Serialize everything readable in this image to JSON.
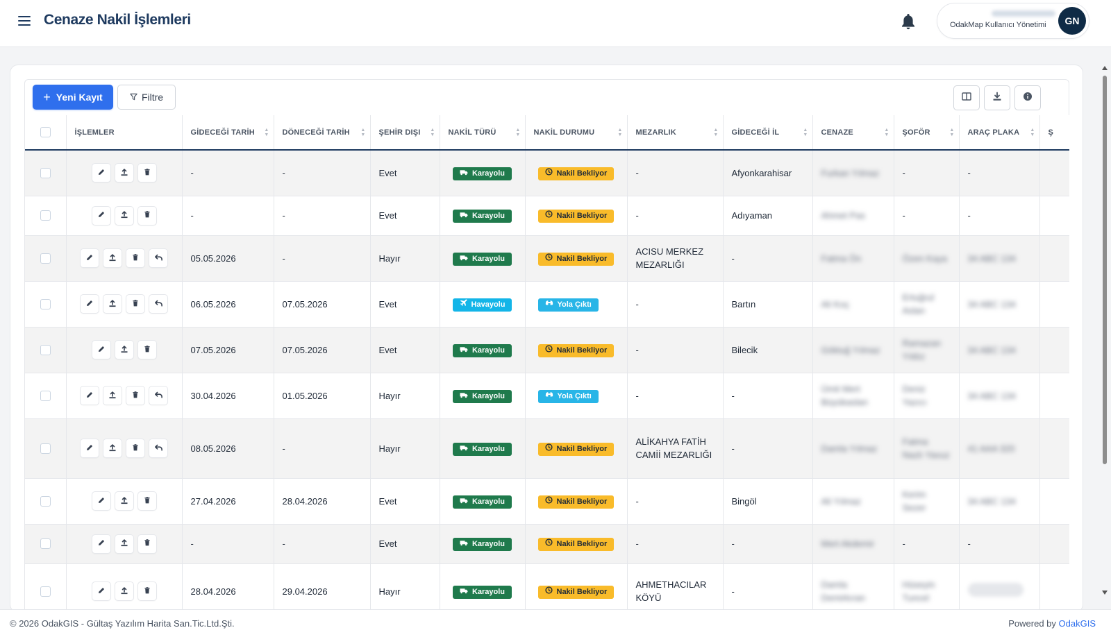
{
  "header": {
    "title": "Cenaze Nakil İşlemleri",
    "user_role": "OdakMap Kullanıcı Yönetimi",
    "avatar_initials": "GN"
  },
  "toolbar": {
    "new_label": "Yeni Kayıt",
    "filter_label": "Filtre"
  },
  "table": {
    "columns": [
      "İŞLEMLER",
      "GİDECEĞİ TARİH",
      "DÖNECEĞİ TARİH",
      "ŞEHİR DIŞI",
      "NAKİL TÜRÜ",
      "NAKİL DURUMU",
      "MEZARLIK",
      "GİDECEĞİ İL",
      "CENAZE",
      "ŞOFÖR",
      "ARAÇ PLAKA",
      "Ş"
    ],
    "rows": [
      {
        "gidecegi_tarih": "-",
        "donecegi_tarih": "-",
        "sehir_disi": "Evet",
        "nakil_turu": "Karayolu",
        "nakil_durumu": "Nakil Bekliyor",
        "mezarlik": "-",
        "gidecegi_il": "Afyonkarahisar",
        "cenaze": "Furkan Yılmaz",
        "sofor": "-",
        "arac_plaka": "-",
        "undo": false
      },
      {
        "gidecegi_tarih": "-",
        "donecegi_tarih": "-",
        "sehir_disi": "Evet",
        "nakil_turu": "Karayolu",
        "nakil_durumu": "Nakil Bekliyor",
        "mezarlik": "-",
        "gidecegi_il": "Adıyaman",
        "cenaze": "Ahmet Pas",
        "sofor": "-",
        "arac_plaka": "-",
        "undo": false
      },
      {
        "gidecegi_tarih": "05.05.2026",
        "donecegi_tarih": "-",
        "sehir_disi": "Hayır",
        "nakil_turu": "Karayolu",
        "nakil_durumu": "Nakil Bekliyor",
        "mezarlik": "ACISU MERKEZ MEZARLIĞI",
        "gidecegi_il": "-",
        "cenaze": "Fatma Ön",
        "sofor": "Özen Kaya",
        "arac_plaka": "34 ABC 134",
        "undo": true
      },
      {
        "gidecegi_tarih": "06.05.2026",
        "donecegi_tarih": "07.05.2026",
        "sehir_disi": "Evet",
        "nakil_turu": "Havayolu",
        "nakil_durumu": "Yola Çıktı",
        "mezarlik": "-",
        "gidecegi_il": "Bartın",
        "cenaze": "Ali Koç",
        "sofor": "Ertuğrul Aslan",
        "arac_plaka": "34 ABC 134",
        "undo": true
      },
      {
        "gidecegi_tarih": "07.05.2026",
        "donecegi_tarih": "07.05.2026",
        "sehir_disi": "Evet",
        "nakil_turu": "Karayolu",
        "nakil_durumu": "Nakil Bekliyor",
        "mezarlik": "-",
        "gidecegi_il": "Bilecik",
        "cenaze": "Göktuğ Yılmaz",
        "sofor": "Ramazan Yıldız",
        "arac_plaka": "34 ABC 134",
        "undo": false
      },
      {
        "gidecegi_tarih": "30.04.2026",
        "donecegi_tarih": "01.05.2026",
        "sehir_disi": "Hayır",
        "nakil_turu": "Karayolu",
        "nakil_durumu": "Yola Çıktı",
        "mezarlik": "-",
        "gidecegi_il": "-",
        "cenaze": "Ümit Mert Büyükaslan",
        "sofor": "Deniz Yazıcı",
        "arac_plaka": "34 ABC 134",
        "undo": true
      },
      {
        "gidecegi_tarih": "08.05.2026",
        "donecegi_tarih": "-",
        "sehir_disi": "Hayır",
        "nakil_turu": "Karayolu",
        "nakil_durumu": "Nakil Bekliyor",
        "mezarlik": "ALİKAHYA FATİH CAMİİ MEZARLIĞI",
        "gidecegi_il": "-",
        "cenaze": "Damla Yılmaz",
        "sofor": "Fatma Nazlı Yavuz",
        "arac_plaka": "41 AAA 320",
        "undo": true
      },
      {
        "gidecegi_tarih": "27.04.2026",
        "donecegi_tarih": "28.04.2026",
        "sehir_disi": "Evet",
        "nakil_turu": "Karayolu",
        "nakil_durumu": "Nakil Bekliyor",
        "mezarlik": "-",
        "gidecegi_il": "Bingöl",
        "cenaze": "Ali Yılmaz",
        "sofor": "Kerim Sezer",
        "arac_plaka": "34 ABC 134",
        "undo": false
      },
      {
        "gidecegi_tarih": "-",
        "donecegi_tarih": "-",
        "sehir_disi": "Evet",
        "nakil_turu": "Karayolu",
        "nakil_durumu": "Nakil Bekliyor",
        "mezarlik": "-",
        "gidecegi_il": "-",
        "cenaze": "Mert Akdemir",
        "sofor": "-",
        "arac_plaka": "-",
        "undo": false
      },
      {
        "gidecegi_tarih": "28.04.2026",
        "donecegi_tarih": "29.04.2026",
        "sehir_disi": "Hayır",
        "nakil_turu": "Karayolu",
        "nakil_durumu": "Nakil Bekliyor",
        "mezarlik": "AHMETHACILAR KÖYÜ",
        "gidecegi_il": "-",
        "cenaze": "Damla Demirkıran",
        "sofor": "Hüseyin Tuncel",
        "arac_plaka": "",
        "undo": false
      }
    ]
  },
  "footer": {
    "copyright": "© 2026 OdakGIS - Gültaş Yazılım Harita San.Tic.Ltd.Şti.",
    "powered_prefix": "Powered by ",
    "powered_link": "OdakGIS"
  },
  "colors": {
    "primary": "#2f6fed",
    "navy": "#1e3a5f",
    "karayolu": "#1f7a4c",
    "havayolu": "#13b5e8",
    "bekliyor": "#f9bb2a",
    "yola": "#28b5e7"
  },
  "icons": {
    "menu": "hamburger-icon",
    "notifications": "bell-icon",
    "add": "plus-icon",
    "filter": "filter-icon",
    "columns": "columns-icon",
    "export": "download-icon",
    "info": "info-icon",
    "edit": "pencil-icon",
    "upload": "upload-icon",
    "delete": "trash-icon",
    "undo": "undo-icon",
    "truck": "truck-icon",
    "plane": "plane-icon",
    "clock": "clock-icon",
    "binoculars": "binoculars-icon"
  }
}
